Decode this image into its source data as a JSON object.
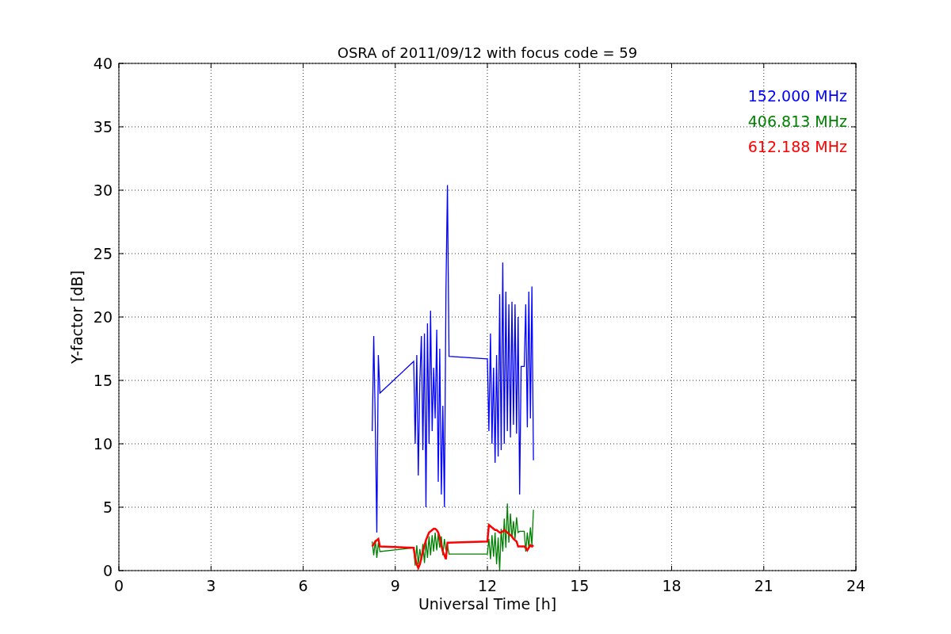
{
  "chart_data": {
    "type": "line",
    "title": "OSRA of 2011/09/12 with focus code = 59",
    "xlabel": "Universal Time [h]",
    "ylabel": "Y-factor [dB]",
    "x": [
      8.25,
      8.3,
      8.35,
      8.4,
      8.45,
      8.5,
      9.6,
      9.65,
      9.7,
      9.75,
      9.8,
      9.85,
      9.9,
      9.95,
      10.0,
      10.05,
      10.1,
      10.15,
      10.2,
      10.25,
      10.3,
      10.35,
      10.4,
      10.45,
      10.5,
      10.55,
      10.6,
      10.65,
      10.7,
      10.75,
      12.0,
      12.05,
      12.1,
      12.15,
      12.2,
      12.25,
      12.3,
      12.35,
      12.4,
      12.45,
      12.5,
      12.55,
      12.6,
      12.65,
      12.7,
      12.75,
      12.8,
      12.85,
      12.9,
      12.95,
      13.0,
      13.05,
      13.1,
      13.15,
      13.2,
      13.25,
      13.3,
      13.35,
      13.4,
      13.45,
      13.5
    ],
    "series": [
      {
        "name": "152.000 MHz",
        "color": "#0000ff",
        "values": [
          11,
          18.5,
          11.5,
          3,
          17,
          14,
          16.5,
          10,
          17,
          7.5,
          15,
          18.5,
          9.5,
          18.7,
          5,
          19.5,
          10,
          20.5,
          11,
          16,
          12,
          19,
          7,
          17.5,
          6,
          13,
          5,
          22,
          30.4,
          16.9,
          16.7,
          11,
          18.7,
          10,
          16,
          8.5,
          17,
          9,
          21.8,
          9.5,
          24.3,
          10,
          22,
          11,
          21,
          10.5,
          21.2,
          11.5,
          21,
          10.8,
          20,
          6,
          16.1,
          16.1,
          16.1,
          21,
          11.3,
          22,
          12,
          22.4,
          8.7
        ]
      },
      {
        "name": "406.813 MHz",
        "color": "#008000",
        "values": [
          2.3,
          1.2,
          2.4,
          1.0,
          2.2,
          1.5,
          1.8,
          0.4,
          2,
          0.5,
          1.7,
          0.8,
          2.1,
          0.6,
          2.4,
          1,
          2.7,
          1.2,
          2.8,
          1.5,
          3,
          1.6,
          2.9,
          1.8,
          2.7,
          1.2,
          2.5,
          1.6,
          2.0,
          1.3,
          1.3,
          2.5,
          0.9,
          2.8,
          1.1,
          3,
          0.5,
          2.6,
          0,
          3.3,
          1.5,
          4.1,
          1.8,
          5.3,
          2.2,
          4.5,
          2.6,
          3.9,
          2.5,
          4.2,
          3,
          3.1,
          3.1,
          3.1,
          3.1,
          1.5,
          3,
          1.8,
          3.4,
          2,
          4.8
        ]
      },
      {
        "name": "612.188 MHz",
        "color": "#ff0000",
        "values": [
          1.9,
          2.1,
          2.3,
          2.4,
          2.5,
          1.9,
          1.8,
          1.0,
          0.5,
          0.2,
          0.5,
          1.0,
          1.5,
          2.0,
          2.4,
          2.7,
          3.0,
          3.1,
          3.2,
          3.3,
          3.3,
          3.2,
          3.0,
          2.6,
          2.0,
          1.5,
          1.2,
          0.9,
          2.2,
          2.2,
          2.3,
          3.6,
          3.5,
          3.4,
          3.3,
          3.2,
          3.2,
          3.1,
          3.0,
          3.0,
          3.1,
          3.2,
          3.1,
          3.0,
          2.9,
          2.8,
          2.7,
          2.5,
          2.4,
          2.3,
          1.9,
          1.9,
          1.9,
          1.9,
          1.9,
          1.8,
          1.6,
          1.8,
          2.0,
          1.9,
          2.0
        ]
      }
    ],
    "xlim": [
      0,
      24
    ],
    "ylim": [
      0,
      40
    ],
    "xticks": [
      0,
      3,
      6,
      9,
      12,
      15,
      18,
      21,
      24
    ],
    "yticks": [
      0,
      5,
      10,
      15,
      20,
      25,
      30,
      35,
      40
    ],
    "grid": true
  }
}
